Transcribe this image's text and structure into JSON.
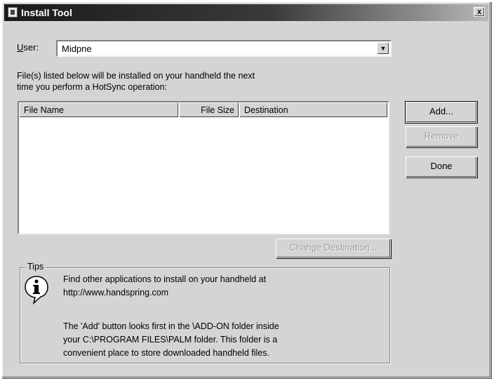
{
  "window": {
    "title": "Install Tool",
    "close_glyph": "x"
  },
  "user": {
    "label_accel": "U",
    "label_rest": "ser:",
    "value": "Midpne",
    "dropdown_glyph": "▼"
  },
  "info": {
    "line1": "File(s) listed below will be installed on your handheld the next",
    "line2": "time you perform a HotSync operation:"
  },
  "file_list": {
    "columns": [
      "File Name",
      "File Size",
      "Destination"
    ],
    "rows": []
  },
  "buttons": {
    "add": "Add...",
    "remove": "Remove",
    "done": "Done",
    "change_destination": "Change Destination..."
  },
  "tips": {
    "legend": "Tips",
    "icon": "info-icon",
    "p1_line1": "Find other applications to install on your handheld at",
    "p1_line2": "http://www.handspring.com",
    "p2_line1": "The 'Add' button looks first in the \\ADD-ON folder inside",
    "p2_line2": "your C:\\PROGRAM FILES\\PALM folder. This folder is a",
    "p2_line3": "convenient place to store downloaded handheld files."
  }
}
